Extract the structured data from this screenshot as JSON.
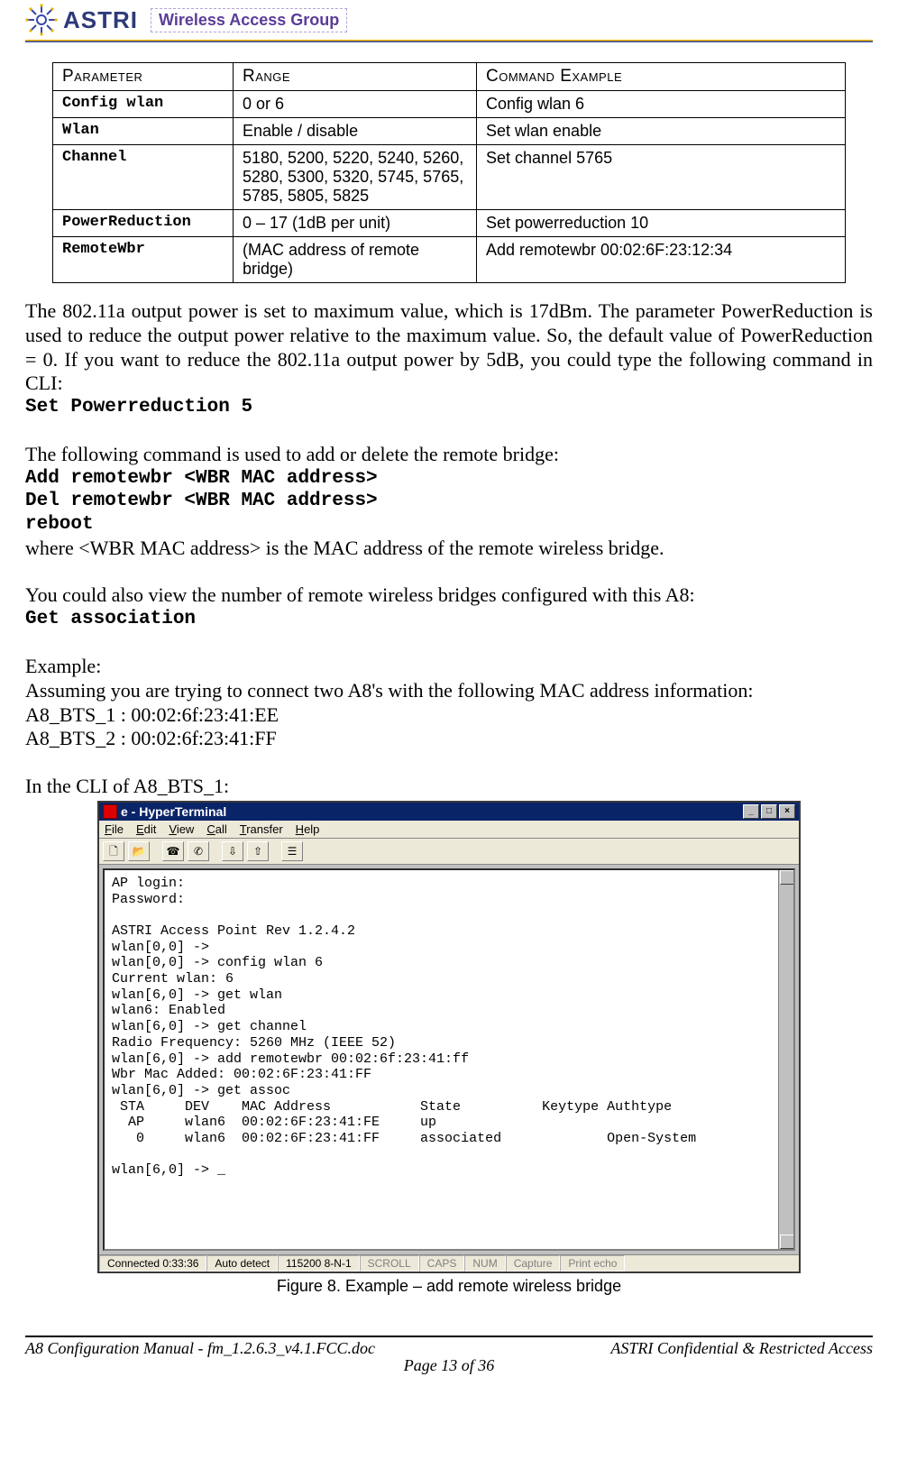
{
  "header": {
    "brand": "ASTRI",
    "wag_label": "Wireless Access Group"
  },
  "table": {
    "head": {
      "c1": "Parameter",
      "c2": "Range",
      "c3": "Command Example"
    },
    "rows": [
      {
        "p": "Config wlan",
        "r": "0 or 6",
        "e": "Config wlan 6"
      },
      {
        "p": "Wlan",
        "r": "Enable / disable",
        "e": "Set wlan enable"
      },
      {
        "p": "Channel",
        "r": "5180, 5200, 5220, 5240, 5260, 5280, 5300, 5320, 5745, 5765, 5785, 5805, 5825",
        "e": "Set channel 5765"
      },
      {
        "p": "PowerReduction",
        "r": "0 – 17 (1dB per unit)",
        "e": "Set powerreduction 10"
      },
      {
        "p": "RemoteWbr",
        "r": "(MAC address of remote bridge)",
        "e": "Add remotewbr 00:02:6F:23:12:34"
      }
    ]
  },
  "body": {
    "p1": "The 802.11a output power is set to maximum value, which is 17dBm. The parameter PowerReduction is used to reduce the output power relative to the maximum value. So, the default value of PowerReduction = 0. If you want to reduce the 802.11a output power by 5dB, you could type the following command in CLI:",
    "cmd1": "Set Powerreduction 5",
    "p2": "The following command is used to add or delete the remote bridge:",
    "cmd2a": "Add remotewbr <WBR MAC address>",
    "cmd2b": "Del remotewbr <WBR MAC address>",
    "cmd2c": "reboot",
    "p2note": "where <WBR MAC address> is the MAC address of the remote wireless bridge.",
    "p3": "You could also view the number of remote wireless bridges configured with this A8:",
    "cmd3": "Get association",
    "p4a": "Example:",
    "p4b": "Assuming you are trying to connect two A8's with the following MAC address information:",
    "mac1": "A8_BTS_1 : 00:02:6f:23:41:EE",
    "mac2": "A8_BTS_2 : 00:02:6f:23:41:FF",
    "p5": "In the CLI of A8_BTS_1:"
  },
  "terminal": {
    "title": "e - HyperTerminal",
    "menu": {
      "file": "File",
      "edit": "Edit",
      "view": "View",
      "call": "Call",
      "transfer": "Transfer",
      "help": "Help"
    },
    "text": "AP login:\nPassword:\n\nASTRI Access Point Rev 1.2.4.2\nwlan[0,0] ->\nwlan[0,0] -> config wlan 6\nCurrent wlan: 6\nwlan[6,0] -> get wlan\nwlan6: Enabled\nwlan[6,0] -> get channel\nRadio Frequency: 5260 MHz (IEEE 52)\nwlan[6,0] -> add remotewbr 00:02:6f:23:41:ff\nWbr Mac Added: 00:02:6F:23:41:FF\nwlan[6,0] -> get assoc\n STA     DEV    MAC Address           State          Keytype Authtype\n  AP     wlan6  00:02:6F:23:41:FE     up\n   0     wlan6  00:02:6F:23:41:FF     associated             Open-System\n\nwlan[6,0] -> _",
    "status": {
      "conn": "Connected 0:33:36",
      "detect": "Auto detect",
      "line": "115200 8-N-1",
      "scroll": "SCROLL",
      "caps": "CAPS",
      "num": "NUM",
      "capture": "Capture",
      "echo": "Print echo"
    },
    "buttons": {
      "min": "_",
      "max": "□",
      "close": "×"
    }
  },
  "caption": "Figure 8. Example – add remote wireless bridge",
  "footer": {
    "left": "A8 Configuration Manual - fm_1.2.6.3_v4.1.FCC.doc",
    "right": "ASTRI Confidential & Restricted Access",
    "page": "Page 13 of 36"
  }
}
